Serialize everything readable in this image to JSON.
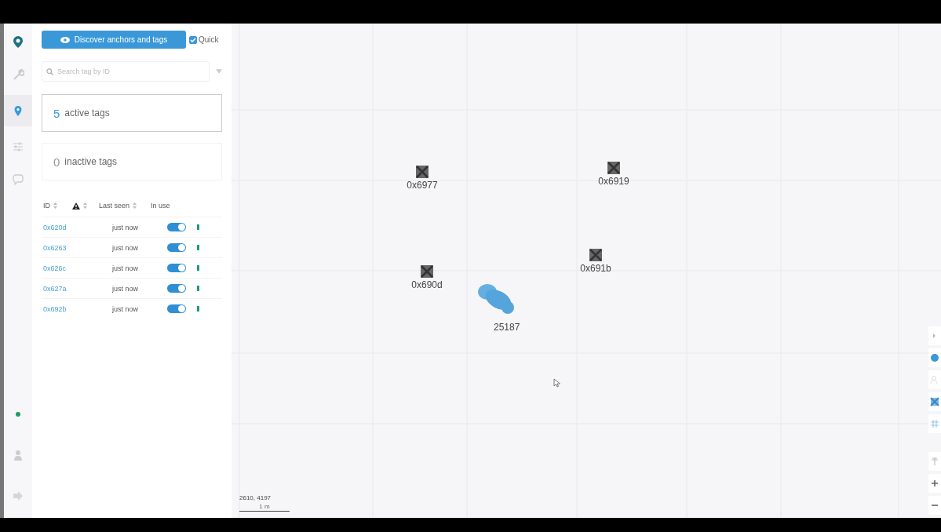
{
  "rail": {
    "items": [
      {
        "kind": "logo"
      },
      {
        "kind": "wrench",
        "selected": false
      },
      {
        "kind": "pin",
        "selected": true
      },
      {
        "kind": "sliders",
        "selected": false
      },
      {
        "kind": "chat",
        "selected": false
      }
    ],
    "bottom": [
      {
        "kind": "status",
        "color": "#1a9e6a"
      },
      {
        "kind": "person"
      },
      {
        "kind": "logout"
      }
    ]
  },
  "panel": {
    "discover_button": "Discover anchors and tags",
    "quick": {
      "label": "Quick",
      "checked": true
    },
    "search": {
      "placeholder": "Search tag by ID"
    },
    "cards": [
      {
        "count": "5",
        "label": "active tags",
        "selected": true
      },
      {
        "count": "0",
        "label": "inactive tags",
        "selected": false
      }
    ],
    "table": {
      "columns": [
        {
          "label": "ID",
          "kind": "sort"
        },
        {
          "kind": "warning-sort"
        },
        {
          "label": "Last seen",
          "kind": "sort"
        },
        {
          "label": "In use",
          "kind": "plain"
        }
      ],
      "rows": [
        {
          "id": "0x620d",
          "last_seen": "just now",
          "in_use": true,
          "color": "#1a9e6a"
        },
        {
          "id": "0x6263",
          "last_seen": "just now",
          "in_use": true,
          "color": "#1a9e6a"
        },
        {
          "id": "0x626c",
          "last_seen": "just now",
          "in_use": true,
          "color": "#1a9e6a"
        },
        {
          "id": "0x627a",
          "last_seen": "just now",
          "in_use": true,
          "color": "#1a9e6a"
        },
        {
          "id": "0x692b",
          "last_seen": "just now",
          "in_use": true,
          "color": "#1a9e6a"
        }
      ]
    }
  },
  "map": {
    "anchors": [
      {
        "label": "0x6977"
      },
      {
        "label": "0x6919"
      },
      {
        "label": "0x691b"
      },
      {
        "label": "0x690d"
      }
    ],
    "tag_cluster": {
      "label": "25187"
    },
    "coordinates": "2610, 4197",
    "scale": "1 m",
    "tools": [
      {
        "kind": "expand"
      },
      {
        "kind": "dot",
        "selected": true
      },
      {
        "kind": "person",
        "selected": false
      },
      {
        "kind": "anchor",
        "selected": true
      },
      {
        "kind": "grid",
        "selected": false
      },
      {
        "kind": "pin"
      },
      {
        "kind": "zoom-in"
      },
      {
        "kind": "zoom-out"
      }
    ]
  }
}
